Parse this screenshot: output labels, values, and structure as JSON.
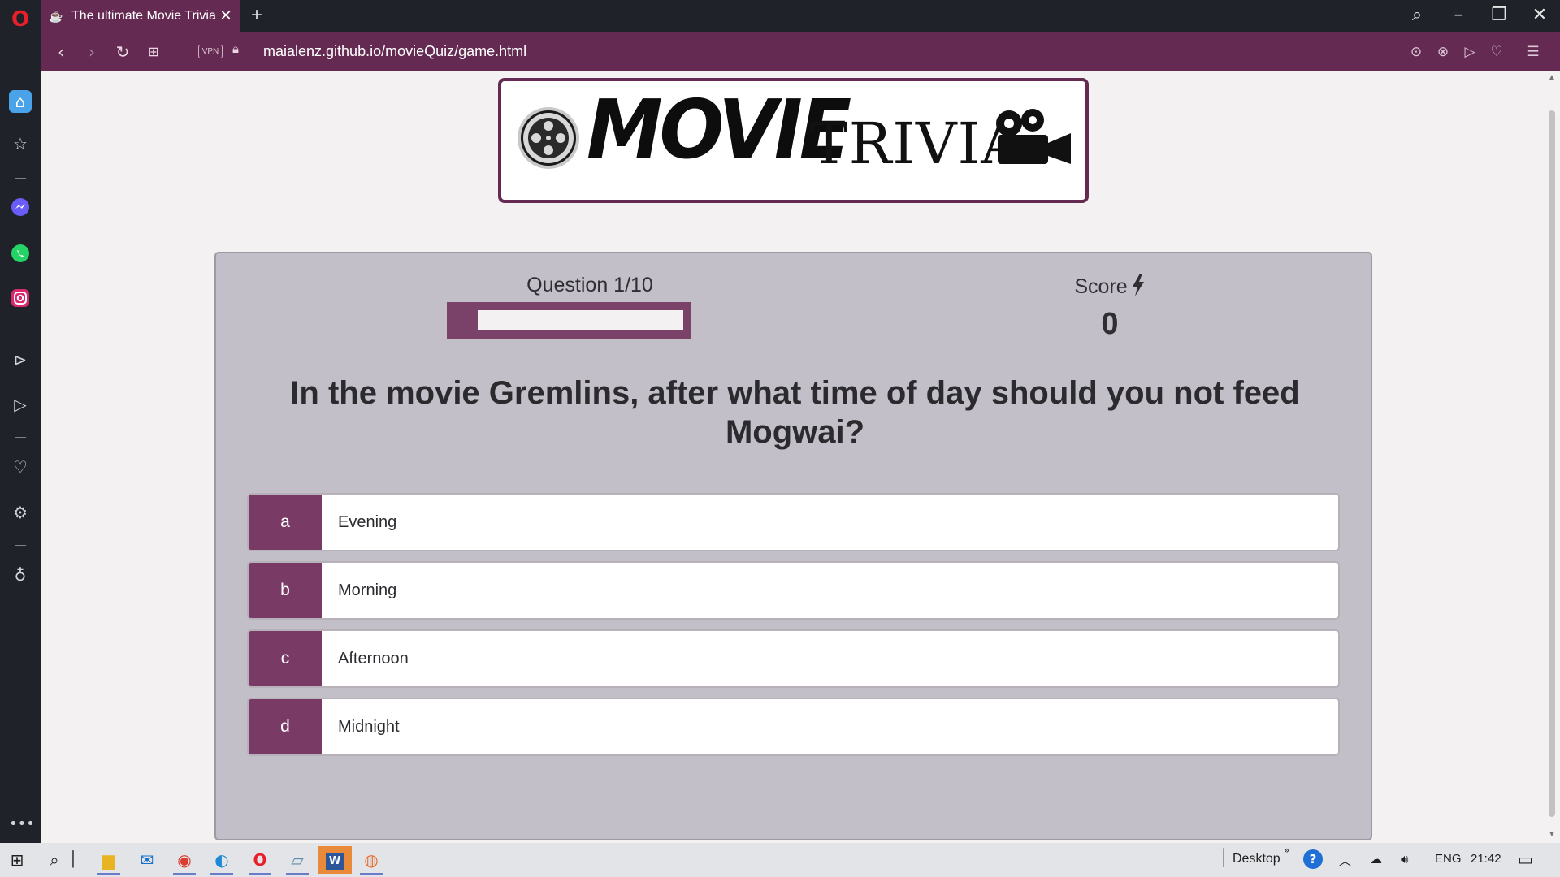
{
  "browser": {
    "tab_title": "The ultimate Movie Trivia",
    "tab_favicon": "☕",
    "url": "maialenz.github.io/movieQuiz/game.html",
    "vpn_label": "VPN",
    "accent_color": "#652a52"
  },
  "page": {
    "logo_text_1": "MOVIE",
    "logo_text_2": "TRIVIA",
    "progress_text": "Question 1/10",
    "progress_fraction": 0.1,
    "score_label": "Score",
    "score_value": "0",
    "question": "In the movie Gremlins, after what time of day should you not feed Mogwai?",
    "choices": [
      {
        "prefix": "a",
        "text": "Evening"
      },
      {
        "prefix": "b",
        "text": "Morning"
      },
      {
        "prefix": "c",
        "text": "Afternoon"
      },
      {
        "prefix": "d",
        "text": "Midnight"
      }
    ]
  },
  "sidebar_icons": [
    "home-icon",
    "star-icon",
    "messenger-icon",
    "whatsapp-icon",
    "instagram-icon",
    "player-icon",
    "send-icon",
    "heart-icon",
    "settings-icon",
    "lightbulb-icon",
    "more-icon"
  ],
  "taskbar": {
    "desktop_label": "Desktop",
    "language": "ENG",
    "time": "21:42"
  }
}
